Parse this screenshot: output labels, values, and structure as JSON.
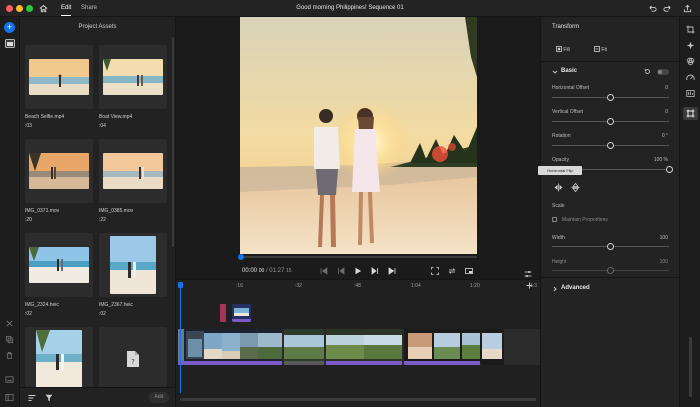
{
  "titlebar": {
    "tabs": [
      "Edit",
      "Share"
    ],
    "title": "Good morning Philippines! Sequence 01"
  },
  "assets": {
    "title": "Project Assets",
    "items": [
      {
        "name": "Beach Selfie.mp4",
        "duration": ":03"
      },
      {
        "name": "Boat View.mp4",
        "duration": ":04"
      },
      {
        "name": "IMG_0371.mov",
        "duration": ":20"
      },
      {
        "name": "IMG_0385.mov",
        "duration": ":22"
      },
      {
        "name": "IMG_2324.heic",
        "duration": ":02"
      },
      {
        "name": "IMG_2367.heic",
        "duration": ":02"
      },
      {
        "name": "",
        "duration": ""
      },
      {
        "name": "",
        "duration": ""
      }
    ],
    "add_label": "Add"
  },
  "monitor": {
    "current_time": "00:00",
    "current_frames": "00",
    "duration": "01:27",
    "duration_frames": "15",
    "progress": 0.0
  },
  "timeline": {
    "ruler": [
      ":16",
      ":32",
      ":48",
      "1:04",
      "1:20",
      "1:3"
    ]
  },
  "transform": {
    "title": "Transform",
    "fill_label": "Fill",
    "fit_label": "Fit",
    "section_basic": "Basic",
    "horizontal_offset": {
      "label": "Horizontal Offset",
      "value": "0",
      "level": 0.5
    },
    "vertical_offset": {
      "label": "Vertical Offset",
      "value": "0",
      "level": 0.5
    },
    "rotation": {
      "label": "Rotation",
      "value": "0 °",
      "level": 0.5
    },
    "opacity": {
      "label": "Opacity",
      "value": "100 %",
      "level": 1.0
    },
    "tooltip": "Horizontal Flip",
    "scale_label": "Scale",
    "maintain_label": "Maintain Proportions",
    "width": {
      "label": "Width",
      "value": "100",
      "level": 0.5
    },
    "height": {
      "label": "Height",
      "value": "100",
      "level": 0.5
    },
    "section_advanced": "Advanced"
  },
  "colors": {
    "accent": "#1473e6",
    "clip_purple": "#7a5cc9",
    "clip_pink": "#a73358"
  }
}
